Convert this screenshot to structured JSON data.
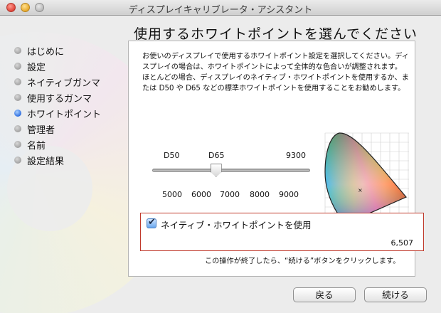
{
  "window": {
    "title": "ディスプレイキャリブレータ・アシスタント"
  },
  "header": {
    "title": "使用するホワイトポイントを選んでください"
  },
  "sidebar": {
    "items": [
      {
        "label": "はじめに",
        "active": false
      },
      {
        "label": "設定",
        "active": false
      },
      {
        "label": "ネイティブガンマ",
        "active": false
      },
      {
        "label": "使用するガンマ",
        "active": false
      },
      {
        "label": "ホワイトポイント",
        "active": true
      },
      {
        "label": "管理者",
        "active": false
      },
      {
        "label": "名前",
        "active": false
      },
      {
        "label": "設定結果",
        "active": false
      }
    ]
  },
  "main": {
    "description": "お使いのディスプレイで使用するホワイトポイント設定を選択してください。ディスプレイの場合は、ホワイトポイントによって全体的な色合いが調整されます。ほとんどの場合、ディスプレイのネイティブ・ホワイトポイントを使用するか、または D50 や D65 などの標準ホワイトポイントを使用することをお勧めします。",
    "slider": {
      "markers": [
        "D50",
        "D65",
        "9300"
      ],
      "scale": [
        "5000",
        "6000",
        "7000",
        "8000",
        "9000"
      ],
      "value": 6507
    },
    "native": {
      "checkbox_label": "ネイティブ・ホワイトポイントを使用",
      "checked": true,
      "value": "6,507"
    },
    "note": "この操作が終了したら、“続ける”ボタンをクリックします。"
  },
  "buttons": {
    "back": "戻る",
    "continue": "続ける"
  },
  "colors": {
    "accent_blue": "#2f6fe0",
    "highlight_red": "#c0392b"
  },
  "icons": {
    "checkbox": "checkmark-icon"
  }
}
